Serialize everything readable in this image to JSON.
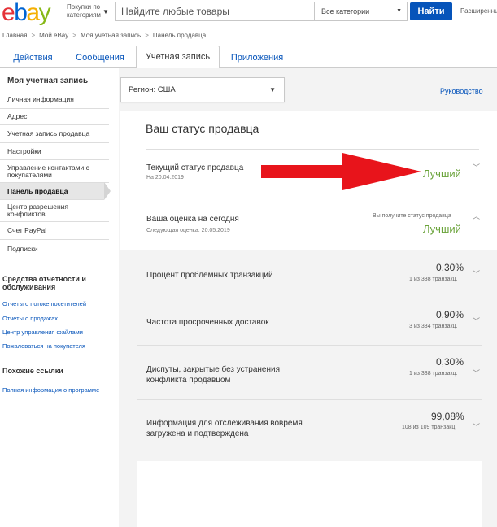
{
  "header": {
    "logo_letters": [
      "e",
      "b",
      "a",
      "y"
    ],
    "logo_colors": [
      "#e53238",
      "#0064d2",
      "#f5af02",
      "#86b817"
    ],
    "shop_by_line1": "Покупки по",
    "shop_by_line2": "категориям",
    "search_placeholder": "Найдите любые товары",
    "category_select": "Все категории",
    "search_button": "Найти",
    "advanced_link": "Расширенный"
  },
  "breadcrumb": [
    "Главная",
    "Мой eBay",
    "Моя учетная запись",
    "Панель продавца"
  ],
  "tabs": [
    {
      "label": "Действия"
    },
    {
      "label": "Сообщения"
    },
    {
      "label": "Учетная запись"
    },
    {
      "label": "Приложения"
    }
  ],
  "sidebar": {
    "title": "Моя учетная запись",
    "items": [
      "Личная информация",
      "Адрес",
      "Учетная запись продавца",
      "Настройки",
      "Управление контактами с покупателями",
      "Панель продавца",
      "Центр разрешения конфликтов",
      "Счет PayPal",
      "Подписки"
    ],
    "reports_title": "Средства отчетности и обслуживания",
    "reports_links": [
      "Отчеты о потоке посетителей",
      "Отчеты о продажах",
      "Центр управления файлами",
      "Пожаловаться на покупателя"
    ],
    "similar_title": "Похожие ссылки",
    "similar_links": [
      "Полная информация о программе"
    ]
  },
  "main": {
    "region_select": "Регион: США",
    "guide_link": "Руководство",
    "status_title": "Ваш статус продавца",
    "current_status_label": "Текущий статус продавца",
    "current_status_date": "На 20.04.2019",
    "current_status_value": "Лучший",
    "today_label": "Ваша оценка на сегодня",
    "today_next": "Следующая оценка: 20.05.2019",
    "today_note": "Вы получите статус продавца",
    "today_value": "Лучший",
    "metrics": [
      {
        "label": "Процент проблемных транзакций",
        "value": "0,30%",
        "count": "1 из 338 транзакц."
      },
      {
        "label": "Частота просроченных доставок",
        "value": "0,90%",
        "count": "3 из 334 транзакц."
      },
      {
        "label": "Диспуты, закрытые без устранения конфликта продавцом",
        "value": "0,30%",
        "count": "1 из 338 транзакц."
      },
      {
        "label": "Информация для отслеживания вовремя загружена и подтверждена",
        "value": "99,08%",
        "count": "108 из 109 транзакц."
      }
    ]
  },
  "colors": {
    "link": "#0654ba",
    "success": "#6aa33a",
    "annotation_arrow": "#e8141b",
    "search_button": "#0654ba"
  }
}
